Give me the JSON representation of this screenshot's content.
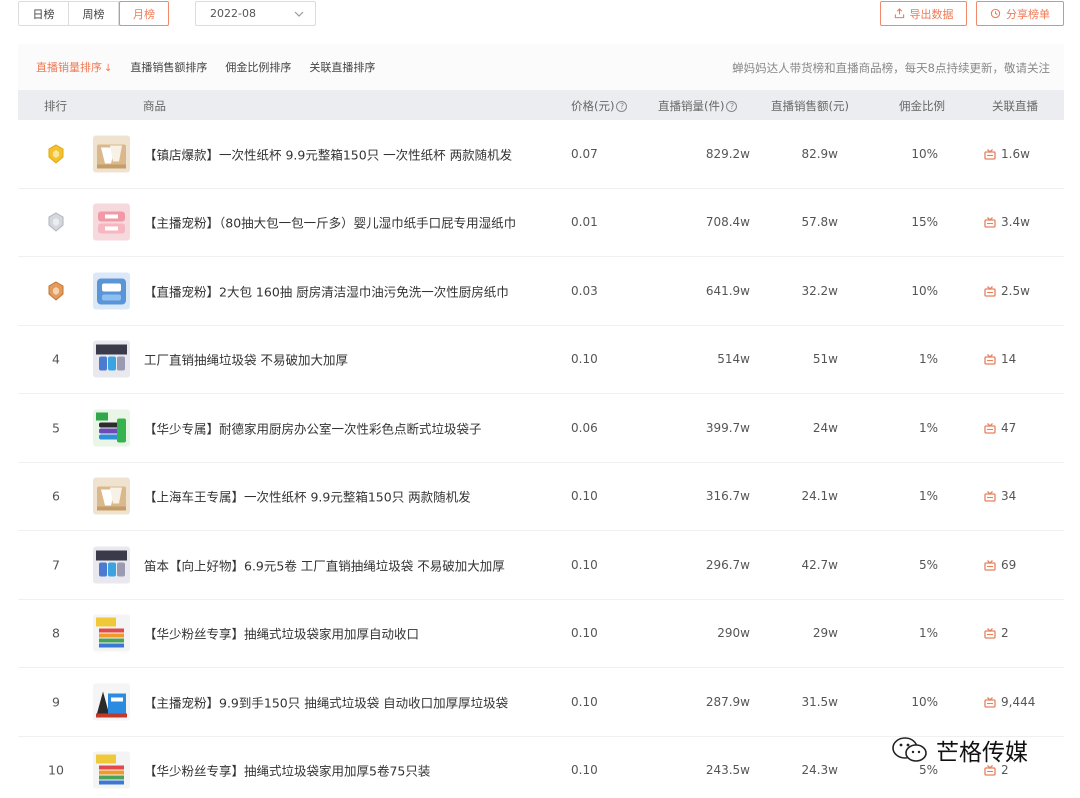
{
  "toolbar": {
    "periods": [
      "日榜",
      "周榜",
      "月榜"
    ],
    "active_period": "月榜",
    "date_value": "2022-08",
    "export_label": "导出数据",
    "share_label": "分享榜单"
  },
  "sortbar": {
    "items": [
      "直播销量排序",
      "直播销售额排序",
      "佣金比例排序",
      "关联直播排序"
    ],
    "notice": "蝉妈妈达人带货榜和直播商品榜，每天8点持续更新，敬请关注"
  },
  "table": {
    "headers": {
      "rank": "排行",
      "product": "商品",
      "price": "价格(元)",
      "sales": "直播销量(件)",
      "amount": "直播销售额(元)",
      "commission": "佣金比例",
      "live": "关联直播"
    },
    "rows": [
      {
        "rank": "1",
        "medal": "gold",
        "thumb": "paper-cups",
        "name": "【镇店爆款】一次性纸杯 9.9元整箱150只 一次性纸杯 两款随机发",
        "price": "0.07",
        "sales": "829.2w",
        "amount": "82.9w",
        "commission": "10%",
        "live": "1.6w"
      },
      {
        "rank": "2",
        "medal": "silver",
        "thumb": "wet-wipes",
        "name": "【主播宠粉】（80抽大包一包一斤多）婴儿湿巾纸手口屁专用湿纸巾",
        "price": "0.01",
        "sales": "708.4w",
        "amount": "57.8w",
        "commission": "15%",
        "live": "3.4w"
      },
      {
        "rank": "3",
        "medal": "bronze",
        "thumb": "kitchen-wipes",
        "name": "【直播宠粉】2大包 160抽 厨房清洁湿巾油污免洗一次性厨房纸巾",
        "price": "0.03",
        "sales": "641.9w",
        "amount": "32.2w",
        "commission": "10%",
        "live": "2.5w"
      },
      {
        "rank": "4",
        "medal": "",
        "thumb": "trash-bags",
        "name": "工厂直销抽绳垃圾袋 不易破加大加厚",
        "price": "0.10",
        "sales": "514w",
        "amount": "51w",
        "commission": "1%",
        "live": "14"
      },
      {
        "rank": "5",
        "medal": "",
        "thumb": "color-bags",
        "name": "【华少专属】耐德家用厨房办公室一次性彩色点断式垃圾袋子",
        "price": "0.06",
        "sales": "399.7w",
        "amount": "24w",
        "commission": "1%",
        "live": "47"
      },
      {
        "rank": "6",
        "medal": "",
        "thumb": "paper-cups",
        "name": "【上海车王专属】一次性纸杯 9.9元整箱150只 两款随机发",
        "price": "0.10",
        "sales": "316.7w",
        "amount": "24.1w",
        "commission": "1%",
        "live": "34"
      },
      {
        "rank": "7",
        "medal": "",
        "thumb": "trash-bags",
        "name": "笛本【向上好物】6.9元5卷 工厂直销抽绳垃圾袋 不易破加大加厚",
        "price": "0.10",
        "sales": "296.7w",
        "amount": "42.7w",
        "commission": "5%",
        "live": "69"
      },
      {
        "rank": "8",
        "medal": "",
        "thumb": "rainbow-bags",
        "name": "【华少粉丝专享】抽绳式垃圾袋家用加厚自动收口",
        "price": "0.10",
        "sales": "290w",
        "amount": "29w",
        "commission": "1%",
        "live": "2"
      },
      {
        "rank": "9",
        "medal": "",
        "thumb": "black-bags",
        "name": "【主播宠粉】9.9到手150只 抽绳式垃圾袋 自动收口加厚厚垃圾袋",
        "price": "0.10",
        "sales": "287.9w",
        "amount": "31.5w",
        "commission": "10%",
        "live": "9,444"
      },
      {
        "rank": "10",
        "medal": "",
        "thumb": "rainbow-bags",
        "name": "【华少粉丝专享】抽绳式垃圾袋家用加厚5卷75只装",
        "price": "0.10",
        "sales": "243.5w",
        "amount": "24.3w",
        "commission": "5%",
        "live": "2"
      }
    ]
  },
  "watermark": "芒格传媒",
  "colors": {
    "accent": "#f07a55",
    "header_bg": "#ecedf0",
    "gold": "#f3c22b",
    "silver": "#c8ccd2",
    "bronze": "#d98b4a"
  }
}
